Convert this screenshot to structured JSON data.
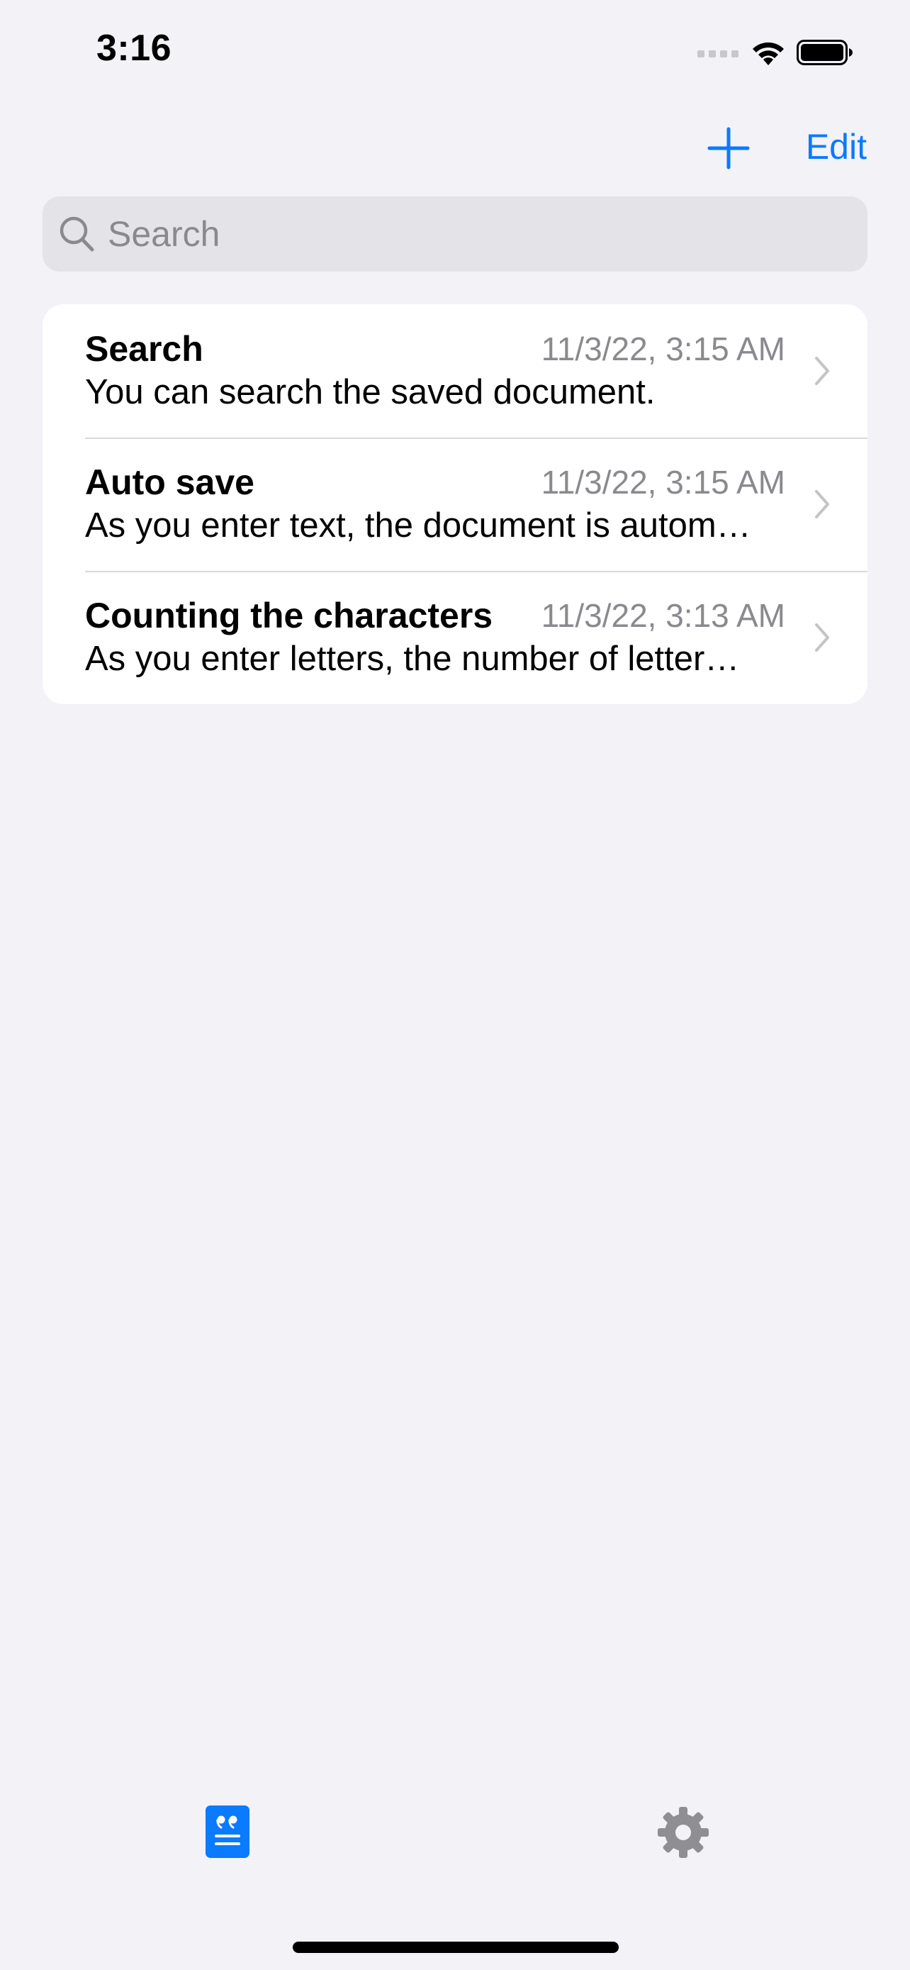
{
  "status_bar": {
    "time": "3:16",
    "icons": [
      "cellular-signal-icon",
      "wifi-icon",
      "battery-icon"
    ]
  },
  "nav": {
    "add_icon": "plus-icon",
    "edit_label": "Edit"
  },
  "search": {
    "placeholder": "Search",
    "value": "",
    "icon": "magnifying-glass-icon"
  },
  "documents": [
    {
      "title": "Search",
      "date": "11/3/22, 3:15 AM",
      "preview": "You can search the saved document."
    },
    {
      "title": "Auto save",
      "date": "11/3/22, 3:15 AM",
      "preview": "As you enter text, the document is autom…"
    },
    {
      "title": "Counting the characters",
      "date": "11/3/22, 3:13 AM",
      "preview": "As you enter letters, the number of letter…"
    }
  ],
  "tab_bar": {
    "tabs": [
      {
        "icon": "document-quote-icon",
        "selected": true
      },
      {
        "icon": "gear-icon",
        "selected": false
      }
    ]
  },
  "colors": {
    "accent": "#0A7AFF",
    "background": "#F2F2F7",
    "secondary_text": "#8A8A8E",
    "inactive_tab": "#8E8E93"
  }
}
